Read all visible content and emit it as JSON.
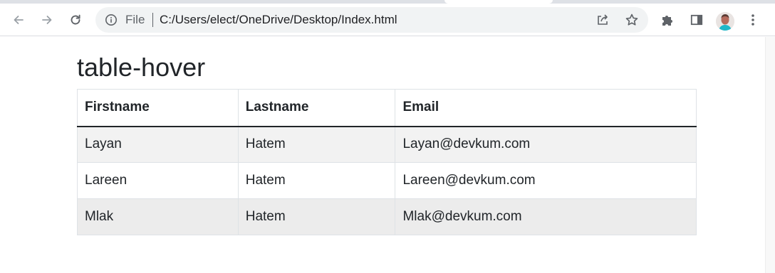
{
  "browser": {
    "scheme_label": "File",
    "url": "C:/Users/elect/OneDrive/Desktop/Index.html",
    "buttons": {
      "back": "back-arrow-icon",
      "forward": "forward-arrow-icon",
      "reload": "reload-icon",
      "share": "share-icon",
      "bookmark": "star-icon",
      "extensions": "puzzle-icon",
      "side_panel": "side-panel-icon",
      "menu": "kebab-menu-icon"
    }
  },
  "page": {
    "title": "table-hover",
    "table": {
      "headers": [
        "Firstname",
        "Lastname",
        "Email"
      ],
      "rows": [
        [
          "Layan",
          "Hatem",
          "Layan@devkum.com"
        ],
        [
          "Lareen",
          "Hatem",
          "Lareen@devkum.com"
        ],
        [
          "Mlak",
          "Hatem",
          "Mlak@devkum.com"
        ]
      ]
    }
  },
  "colors": {
    "striped_row": "#f2f2f2",
    "hovered_row": "#ececec",
    "border": "#dee2e6",
    "header_rule": "#212529",
    "omnibox_bg": "#f1f3f4"
  }
}
